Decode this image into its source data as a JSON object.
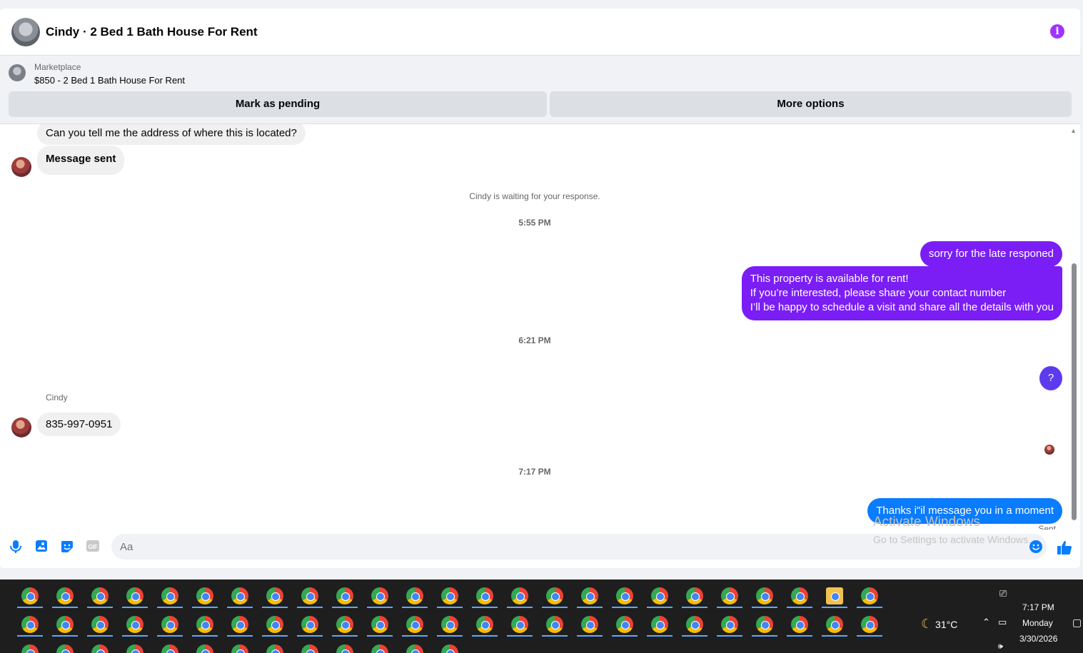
{
  "header": {
    "title": "Cindy · 2 Bed 1 Bath House For Rent",
    "info_glyph": "i"
  },
  "marketplace": {
    "label": "Marketplace",
    "item": "$850 - 2 Bed 1 Bath House For Rent",
    "pending_label": "Mark as pending",
    "more_label": "More options"
  },
  "messages": {
    "in1": "Can you tell me the address of where this is located?",
    "in2": "Message sent",
    "waiting_note": "Cindy is waiting for your response.",
    "time1": "5:55 PM",
    "out1": "sorry for the late responed",
    "out2_line1": "This property is available for rent!",
    "out2_line2": "If you’re interested, please share your contact number",
    "out2_line3": "I’ll be happy to schedule a visit and share all the details with you",
    "time2": "6:21 PM",
    "out3": "?",
    "sender_name": "Cindy",
    "in3": "835-997-0951",
    "time3": "7:17 PM",
    "out4": "Thanks i\"il message you in a moment",
    "status": "Sent"
  },
  "composer": {
    "placeholder": "Aa"
  },
  "watermark": {
    "line1": "Activate Windows",
    "line2": "Go to Settings to activate Windows."
  },
  "taskbar": {
    "temperature": "31°C",
    "time": "7:17 PM",
    "day": "Monday",
    "date": "3/30/2026"
  },
  "colors": {
    "accent_purple": "#a033ff",
    "bubble_purple": "#7a1ef5",
    "bubble_violet": "#5c3bef",
    "bubble_blue": "#0a7cff"
  },
  "icons": [
    "info-icon",
    "mic-icon",
    "image-icon",
    "sticker-icon",
    "gif-icon",
    "emoji-icon",
    "like-icon",
    "chrome-icon",
    "folder-icon",
    "moon-icon",
    "chevron-up-icon",
    "network-icon",
    "speaker-icon",
    "notification-icon"
  ]
}
